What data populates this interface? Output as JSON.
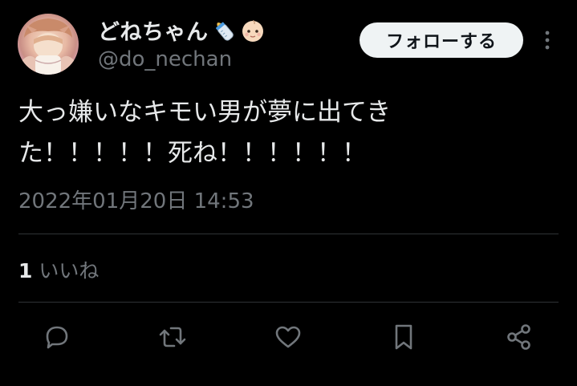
{
  "author": {
    "display_name": "どねちゃん",
    "handle": "@do_nechan",
    "name_emojis": [
      "baby-bottle-icon",
      "baby-face-icon"
    ],
    "avatar": "anime-avatar-image"
  },
  "header": {
    "follow_label": "フォローする",
    "more_icon": "more-vertical-icon"
  },
  "tweet": {
    "text": "大っ嫌いなキモい男が夢に出てき\nた！！！！！死ね！！！！！！",
    "timestamp": "2022年01月20日 14:53"
  },
  "stats": {
    "likes_count": "1",
    "likes_label": "いいね"
  },
  "actions": [
    "reply-icon",
    "retweet-icon",
    "like-icon",
    "bookmark-icon",
    "share-icon"
  ],
  "colors": {
    "background": "#000000",
    "text_primary": "#e7e9ea",
    "text_secondary": "#71767b",
    "divider": "#2f3336",
    "follow_button_bg": "#eff3f4",
    "follow_button_text": "#0f1419"
  }
}
